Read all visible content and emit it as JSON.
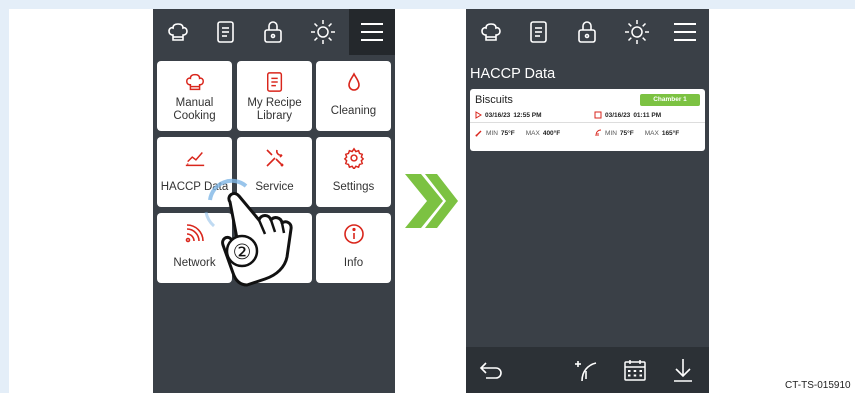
{
  "left_screen": {
    "tiles": [
      {
        "label": "Manual\nCooking",
        "icon": "chef-hat-icon"
      },
      {
        "label": "My Recipe\nLibrary",
        "icon": "recipe-book-icon"
      },
      {
        "label": "Cleaning",
        "icon": "water-drop-icon"
      },
      {
        "label": "HACCP Data",
        "icon": "chart-icon"
      },
      {
        "label": "Service",
        "icon": "tools-icon"
      },
      {
        "label": "Settings",
        "icon": "gear-icon"
      },
      {
        "label": "Network",
        "icon": "wifi-icon"
      },
      {
        "label": "",
        "icon": "hidden-tile"
      },
      {
        "label": "Info",
        "icon": "info-icon"
      }
    ],
    "step_number": "②"
  },
  "right_screen": {
    "title": "HACCP Data",
    "record": {
      "name": "Biscuits",
      "chamber": "Chamber 1",
      "start_date": "03/16/23",
      "start_time": "12:55 PM",
      "end_date": "03/16/23",
      "end_time": "01:11 PM",
      "core_min_label": "MIN",
      "core_min": "75°F",
      "core_max_label": "MAX",
      "core_max": "400°F",
      "probe_min_label": "MIN",
      "probe_min": "75°F",
      "probe_max_label": "MAX",
      "probe_max": "165°F"
    }
  },
  "caption": "CT-TS-015910",
  "colors": {
    "accent_red": "#d9261c",
    "accent_green": "#7cc242",
    "panel_dark": "#3a4047"
  }
}
